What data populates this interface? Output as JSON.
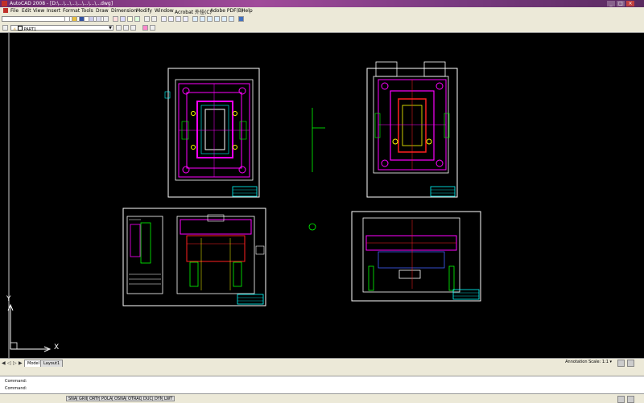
{
  "window": {
    "title": "AutoCAD 2008 - [D:\\...\\...\\...\\...\\...\\...\\...dwg]"
  },
  "menu": [
    "File",
    "Edit",
    "View",
    "Insert",
    "Format",
    "Tools",
    "Draw",
    "Dimension",
    "Modify",
    "Window",
    "Acrobat 外挂(C)",
    "Adobe PDF(B)",
    "Help"
  ],
  "help": {
    "placeholder": "Type a question for help"
  },
  "toolbar": {
    "layer_value": "",
    "style_value": "PART1"
  },
  "tabs": {
    "model": "Model",
    "layout": "Layout1"
  },
  "status": {
    "annotation_scale": "Annotation Scale: 1:1 ▾",
    "coords": "",
    "buttons": [
      "SNAP",
      "GRID",
      "ORTHO",
      "POLAR",
      "OSNAP",
      "OTRACK",
      "DUCS",
      "DYN",
      "LWT"
    ]
  },
  "command": {
    "line1": "Command:",
    "line2": "Command:"
  },
  "ucs": {
    "x": "X",
    "y": "Y"
  },
  "colors": {
    "canvas": "#000000",
    "frame": "#ffffff",
    "magenta": "#ff00ff",
    "green": "#00ff00",
    "cyan": "#00ffff",
    "yellow": "#ffff00",
    "red": "#ff2020",
    "blue": "#4060ff"
  }
}
